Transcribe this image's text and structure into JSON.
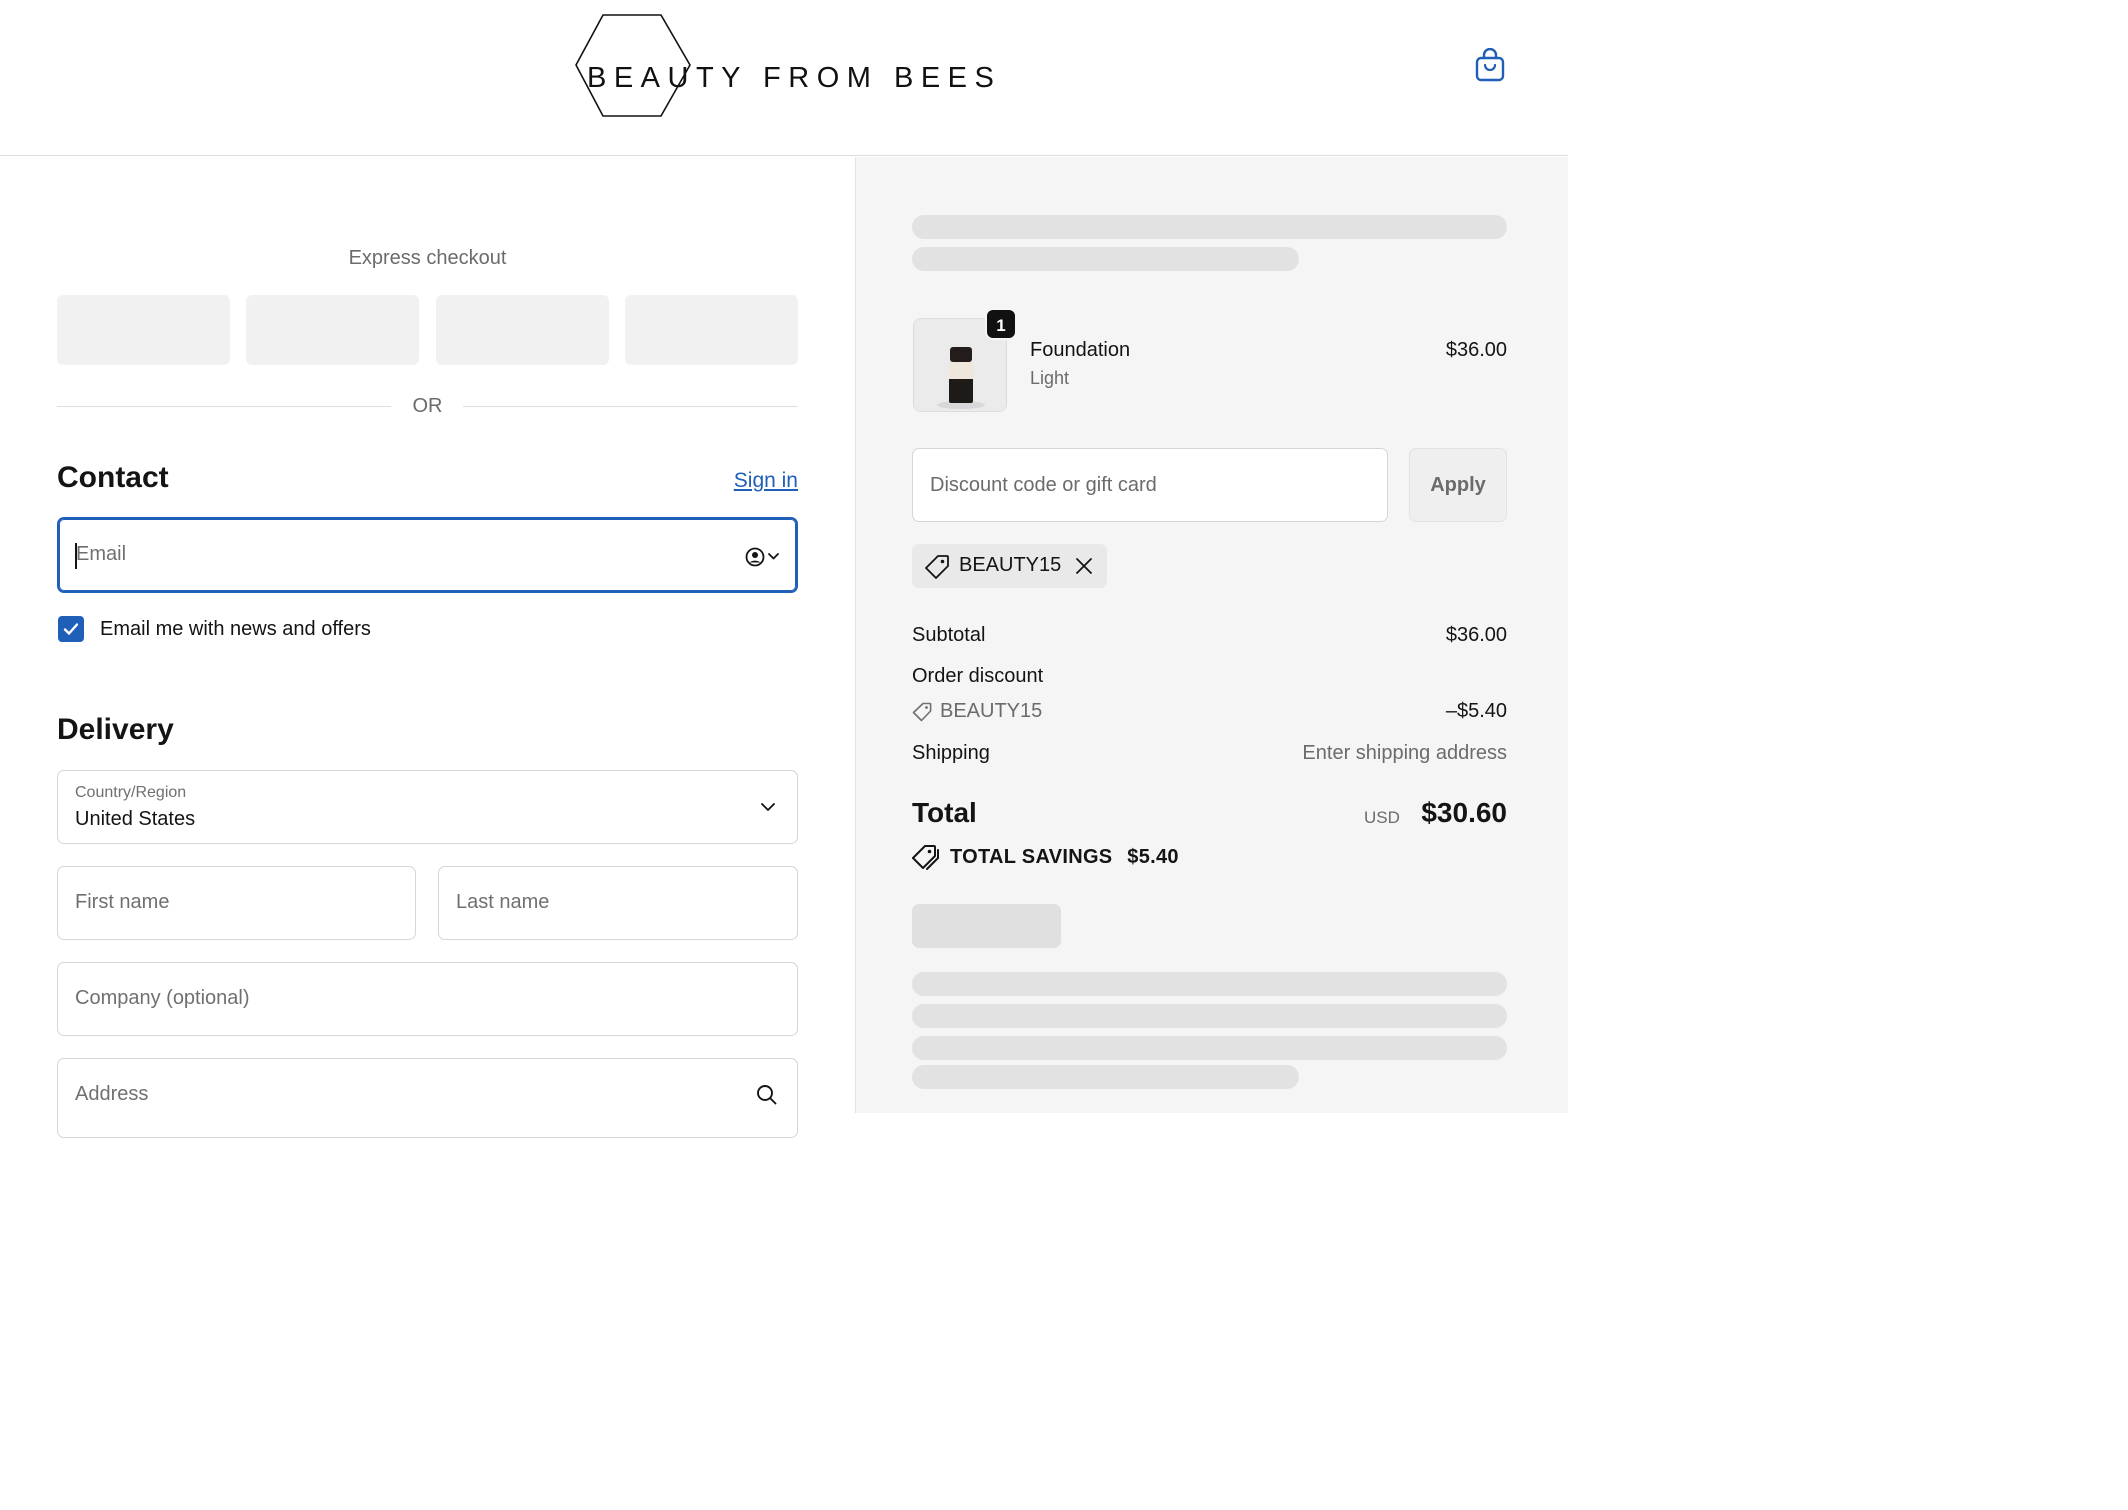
{
  "header": {
    "brand": "BEAUTY FROM BEES",
    "cart_icon": "shopping-bag-icon"
  },
  "express": {
    "title": "Express checkout",
    "or_label": "OR"
  },
  "contact": {
    "title": "Contact",
    "sign_in": "Sign in",
    "email_placeholder": "Email",
    "newsletter_label": "Email me with news and offers",
    "newsletter_checked": true
  },
  "delivery": {
    "title": "Delivery",
    "country_label": "Country/Region",
    "country_value": "United States",
    "first_name_placeholder": "First name",
    "last_name_placeholder": "Last name",
    "company_placeholder": "Company (optional)",
    "address_placeholder": "Address"
  },
  "summary": {
    "item": {
      "quantity": "1",
      "name": "Foundation",
      "variant": "Light",
      "price": "$36.00"
    },
    "discount_placeholder": "Discount code or gift card",
    "apply_label": "Apply",
    "applied_code": "BEAUTY15",
    "subtotal_label": "Subtotal",
    "subtotal_value": "$36.00",
    "order_discount_label": "Order discount",
    "order_discount_code": "BEAUTY15",
    "order_discount_value": "–$5.40",
    "shipping_label": "Shipping",
    "shipping_value": "Enter shipping address",
    "total_label": "Total",
    "total_currency": "USD",
    "total_value": "$30.60",
    "savings_label": "TOTAL SAVINGS",
    "savings_value": "$5.40"
  },
  "colors": {
    "accent": "#1f5fb8",
    "panel": "#f5f5f5",
    "skeleton": "#e2e2e2"
  }
}
